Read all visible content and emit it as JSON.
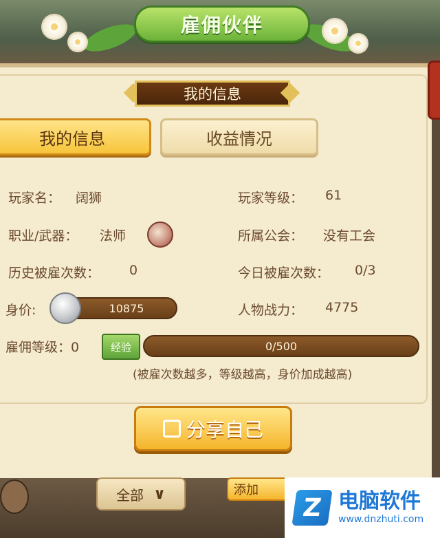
{
  "header": {
    "title": "雇佣伙伴"
  },
  "section_title": "我的信息",
  "tabs": [
    {
      "label": "我的信息",
      "active": true
    },
    {
      "label": "收益情况",
      "active": false
    }
  ],
  "info": {
    "player_name_label": "玩家名：",
    "player_name": "阔狮",
    "player_level_label": "玩家等级：",
    "player_level": "61",
    "class_label": "职业/武器：",
    "class_value": "法师",
    "guild_label": "所属公会：",
    "guild_value": "没有工会",
    "hire_history_label": "历史被雇次数：",
    "hire_history": "0",
    "today_hired_label": "今日被雇次数：",
    "today_hired": "0/3",
    "worth_label": "身价:",
    "worth_value": "10875",
    "power_label": "人物战力：",
    "power_value": "4775",
    "hire_level_label": "雇佣等级：0",
    "hire_level_badge": "经验",
    "exp_text": "0/500",
    "exp_fraction": 0,
    "note": "(被雇次数越多，等级越高，身价加成越高)"
  },
  "share_button_label": "分享自己",
  "bottom": {
    "filter_label": "全部",
    "filter_icon": "chevron-down-icon",
    "add_label": "添加"
  },
  "watermark": {
    "name": "电脑软件",
    "url": "www.dnzhuti.com",
    "logo_letter": "Z"
  },
  "colors": {
    "accent": "#f7c43a",
    "brown": "#6b4a2e",
    "panel": "#f5ebcf",
    "green": "#6cb33a"
  }
}
